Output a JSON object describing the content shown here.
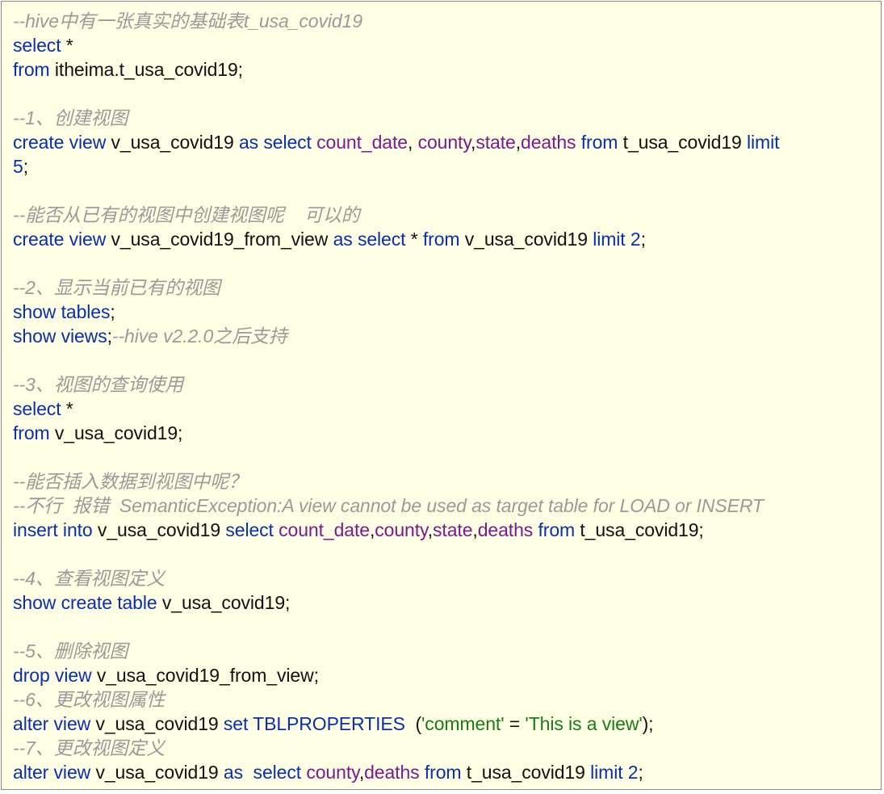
{
  "code_lines": [
    [
      {
        "t": "--hive中有一张真实的基础表t_usa_covid19",
        "c": "cmt"
      }
    ],
    [
      {
        "t": "select",
        "c": "kw"
      },
      {
        "t": " *",
        "c": "plain"
      }
    ],
    [
      {
        "t": "from",
        "c": "kw"
      },
      {
        "t": " itheima.t_usa_covid19;",
        "c": "plain"
      }
    ],
    [],
    [
      {
        "t": "--1、创建视图",
        "c": "cmt"
      }
    ],
    [
      {
        "t": "create view",
        "c": "kw"
      },
      {
        "t": " v_usa_covid19 ",
        "c": "plain"
      },
      {
        "t": "as select",
        "c": "kw"
      },
      {
        "t": " ",
        "c": "plain"
      },
      {
        "t": "count_date",
        "c": "col"
      },
      {
        "t": ", ",
        "c": "plain"
      },
      {
        "t": "county",
        "c": "col"
      },
      {
        "t": ",",
        "c": "plain"
      },
      {
        "t": "state",
        "c": "col"
      },
      {
        "t": ",",
        "c": "plain"
      },
      {
        "t": "deaths",
        "c": "col"
      },
      {
        "t": " ",
        "c": "plain"
      },
      {
        "t": "from",
        "c": "kw"
      },
      {
        "t": " t_usa_covid19 ",
        "c": "plain"
      },
      {
        "t": "limit",
        "c": "kw"
      }
    ],
    [
      {
        "t": "5",
        "c": "kw"
      },
      {
        "t": ";",
        "c": "plain"
      }
    ],
    [],
    [
      {
        "t": "--能否从已有的视图中创建视图呢    可以的",
        "c": "cmt"
      }
    ],
    [
      {
        "t": "create view",
        "c": "kw"
      },
      {
        "t": " v_usa_covid19_from_view ",
        "c": "plain"
      },
      {
        "t": "as select",
        "c": "kw"
      },
      {
        "t": " * ",
        "c": "plain"
      },
      {
        "t": "from",
        "c": "kw"
      },
      {
        "t": " v_usa_covid19 ",
        "c": "plain"
      },
      {
        "t": "limit 2",
        "c": "kw"
      },
      {
        "t": ";",
        "c": "plain"
      }
    ],
    [],
    [
      {
        "t": "--2、显示当前已有的视图",
        "c": "cmt"
      }
    ],
    [
      {
        "t": "show tables",
        "c": "kw"
      },
      {
        "t": ";",
        "c": "plain"
      }
    ],
    [
      {
        "t": "show views",
        "c": "kw"
      },
      {
        "t": ";",
        "c": "plain"
      },
      {
        "t": "--hive v2.2.0之后支持",
        "c": "cmt"
      }
    ],
    [],
    [
      {
        "t": "--3、视图的查询使用",
        "c": "cmt"
      }
    ],
    [
      {
        "t": "select",
        "c": "kw"
      },
      {
        "t": " *",
        "c": "plain"
      }
    ],
    [
      {
        "t": "from",
        "c": "kw"
      },
      {
        "t": " v_usa_covid19;",
        "c": "plain"
      }
    ],
    [],
    [
      {
        "t": "--能否插入数据到视图中呢？",
        "c": "cmt"
      }
    ],
    [
      {
        "t": "--不行  报错  SemanticException:A view cannot be used as target table for LOAD or INSERT",
        "c": "cmt"
      }
    ],
    [
      {
        "t": "insert into",
        "c": "kw"
      },
      {
        "t": " v_usa_covid19 ",
        "c": "plain"
      },
      {
        "t": "select",
        "c": "kw"
      },
      {
        "t": " ",
        "c": "plain"
      },
      {
        "t": "count_date",
        "c": "col"
      },
      {
        "t": ",",
        "c": "plain"
      },
      {
        "t": "county",
        "c": "col"
      },
      {
        "t": ",",
        "c": "plain"
      },
      {
        "t": "state",
        "c": "col"
      },
      {
        "t": ",",
        "c": "plain"
      },
      {
        "t": "deaths",
        "c": "col"
      },
      {
        "t": " ",
        "c": "plain"
      },
      {
        "t": "from",
        "c": "kw"
      },
      {
        "t": " t_usa_covid19;",
        "c": "plain"
      }
    ],
    [],
    [
      {
        "t": "--4、查看视图定义",
        "c": "cmt"
      }
    ],
    [
      {
        "t": "show create table",
        "c": "kw"
      },
      {
        "t": " v_usa_covid19;",
        "c": "plain"
      }
    ],
    [],
    [
      {
        "t": "--5、删除视图",
        "c": "cmt"
      }
    ],
    [
      {
        "t": "drop view",
        "c": "kw"
      },
      {
        "t": " v_usa_covid19_from_view;",
        "c": "plain"
      }
    ],
    [
      {
        "t": "--6、更改视图属性",
        "c": "cmt"
      }
    ],
    [
      {
        "t": "alter view",
        "c": "kw"
      },
      {
        "t": " v_usa_covid19 ",
        "c": "plain"
      },
      {
        "t": "set TBLPROPERTIES",
        "c": "kw"
      },
      {
        "t": "  (",
        "c": "plain"
      },
      {
        "t": "'comment'",
        "c": "str"
      },
      {
        "t": " = ",
        "c": "plain"
      },
      {
        "t": "'This is a view'",
        "c": "str"
      },
      {
        "t": ");",
        "c": "plain"
      }
    ],
    [
      {
        "t": "--7、更改视图定义",
        "c": "cmt"
      }
    ],
    [
      {
        "t": "alter view",
        "c": "kw"
      },
      {
        "t": " v_usa_covid19 ",
        "c": "plain"
      },
      {
        "t": "as  select",
        "c": "kw"
      },
      {
        "t": " ",
        "c": "plain"
      },
      {
        "t": "county",
        "c": "col"
      },
      {
        "t": ",",
        "c": "plain"
      },
      {
        "t": "deaths",
        "c": "col"
      },
      {
        "t": " ",
        "c": "plain"
      },
      {
        "t": "from",
        "c": "kw"
      },
      {
        "t": " t_usa_covid19 ",
        "c": "plain"
      },
      {
        "t": "limit 2",
        "c": "kw"
      },
      {
        "t": ";",
        "c": "plain"
      }
    ]
  ]
}
